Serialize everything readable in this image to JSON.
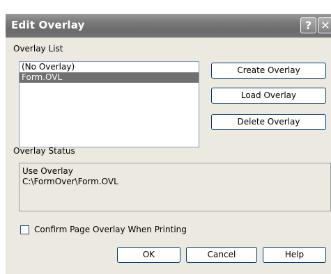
{
  "window": {
    "title": "Edit Overlay",
    "help_symbol": "?",
    "close_symbol": "✕"
  },
  "overlay_list": {
    "label": "Overlay List",
    "items": [
      {
        "label": "(No Overlay)",
        "selected": false
      },
      {
        "label": "Form.OVL",
        "selected": true
      }
    ]
  },
  "buttons": {
    "create": "Create Overlay",
    "load": "Load Overlay",
    "delete": "Delete Overlay",
    "ok": "OK",
    "cancel": "Cancel",
    "help": "Help"
  },
  "overlay_status": {
    "label": "Overlay Status",
    "line1": "Use Overlay",
    "line2": "C:\\FormOver\\Form.OVL"
  },
  "confirm": {
    "label": "Confirm Page Overlay When Printing",
    "checked": false
  },
  "colors": {
    "selection": "#707070",
    "dialog_background": "#ebe9e0",
    "button_border": "#003c74"
  }
}
